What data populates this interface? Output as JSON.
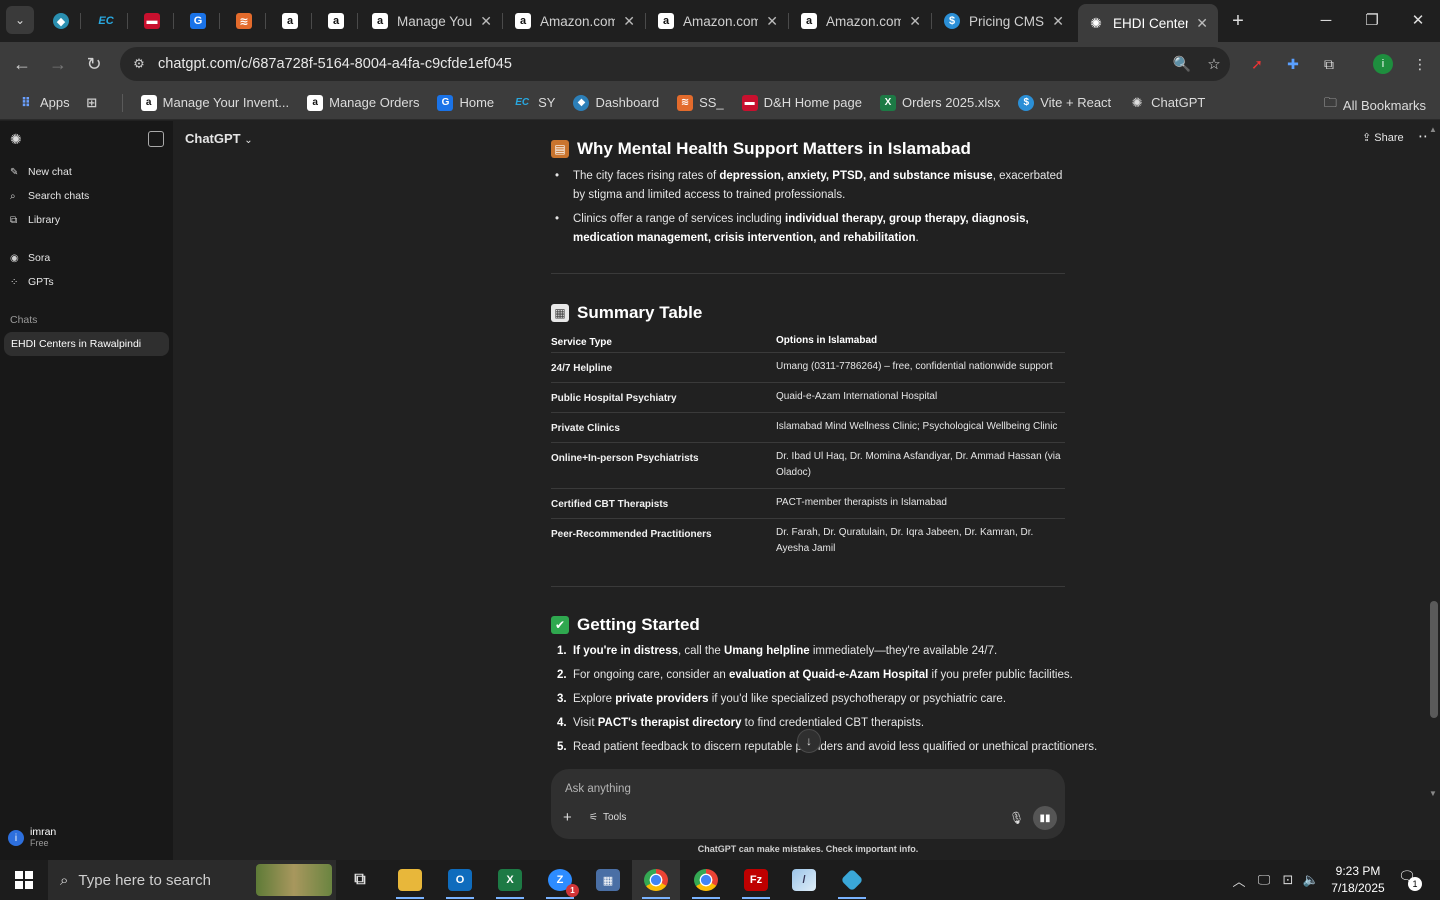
{
  "browser": {
    "tabs": [
      {
        "label": "Manage Your",
        "fav": "a",
        "fav_color": "#ffffff"
      },
      {
        "label": "Amazon.com",
        "fav": "a",
        "fav_color": "#ffffff"
      },
      {
        "label": "Amazon.com",
        "fav": "a",
        "fav_color": "#ffffff"
      },
      {
        "label": "Amazon.com",
        "fav": "a",
        "fav_color": "#ffffff"
      },
      {
        "label": "Pricing CMS",
        "fav": "$",
        "fav_color": "#2b8fd6"
      },
      {
        "label": "EHDI Centers",
        "fav": "✺",
        "fav_color": "#ffffff"
      }
    ],
    "url": "chatgpt.com/c/687a728f-5164-8004-a4fa-c9cfde1ef045",
    "bookmarks": [
      {
        "label": "Apps",
        "icon": "apps-grid-icon"
      },
      {
        "label": "Manage Your Invent...",
        "icon": "amazon-icon"
      },
      {
        "label": "Manage Orders",
        "icon": "amazon-icon"
      },
      {
        "label": "Home",
        "icon": "home-icon"
      },
      {
        "label": "SY",
        "icon": "ec-icon"
      },
      {
        "label": "Dashboard",
        "icon": "dashboard-icon"
      },
      {
        "label": "SS_",
        "icon": "ss-icon"
      },
      {
        "label": "D&H Home page",
        "icon": "dh-icon"
      },
      {
        "label": "Orders 2025.xlsx",
        "icon": "excel-icon"
      },
      {
        "label": "Vite + React",
        "icon": "vite-icon"
      },
      {
        "label": "ChatGPT",
        "icon": "chatgpt-icon"
      }
    ],
    "all_bookmarks": "All Bookmarks",
    "profile_initial": "i"
  },
  "sidebar": {
    "items": [
      {
        "label": "New chat",
        "icon": "pencil-icon"
      },
      {
        "label": "Search chats",
        "icon": "search-icon"
      },
      {
        "label": "Library",
        "icon": "library-icon"
      },
      {
        "label": "Sora",
        "icon": "sora-icon"
      },
      {
        "label": "GPTs",
        "icon": "gpts-icon"
      }
    ],
    "chats_heading": "Chats",
    "active_chat": "EHDI Centers in Rawalpindi",
    "user": {
      "initial": "i",
      "name": "imran",
      "plan": "Free"
    }
  },
  "header": {
    "model": "ChatGPT",
    "share": "Share"
  },
  "content": {
    "section1": {
      "title": "Why Mental Health Support Matters in Islamabad",
      "bullets": [
        {
          "pre": "The city faces rising rates of ",
          "bold": "depression, anxiety, PTSD, and substance misuse",
          "post": ", exacerbated by stigma and limited access to trained professionals."
        },
        {
          "pre": "Clinics offer a range of services including ",
          "bold": "individual therapy, group therapy, diagnosis, medication management, crisis intervention, and rehabilitation",
          "post": "."
        }
      ]
    },
    "section2": {
      "title": "Summary Table",
      "headers": [
        "Service Type",
        "Options in Islamabad"
      ],
      "rows": [
        [
          "24/7 Helpline",
          "Umang (0311-7786264) – free, confidential nationwide support"
        ],
        [
          "Public Hospital Psychiatry",
          "Quaid-e-Azam International Hospital"
        ],
        [
          "Private Clinics",
          "Islamabad Mind Wellness Clinic; Psychological Wellbeing Clinic"
        ],
        [
          "Online+In-person Psychiatrists",
          "Dr. Ibad Ul Haq, Dr. Momina Asfandiyar, Dr. Ammad Hassan (via Oladoc)"
        ],
        [
          "Certified CBT Therapists",
          "PACT-member therapists in Islamabad"
        ],
        [
          "Peer-Recommended Practitioners",
          "Dr. Farah, Dr. Quratulain, Dr. Iqra Jabeen, Dr. Kamran, Dr. Ayesha Jamil"
        ]
      ]
    },
    "section3": {
      "title": "Getting Started",
      "steps": [
        {
          "n": "1.",
          "bold": "If you're in distress",
          "mid": ", call the ",
          "bold2": "Umang helpline",
          "post": " immediately—they're available 24/7."
        },
        {
          "n": "2.",
          "bold": "",
          "mid": "For ongoing care, consider an ",
          "bold2": "evaluation at Quaid-e-Azam Hospital",
          "post": " if you prefer public facilities."
        },
        {
          "n": "3.",
          "bold": "",
          "mid": "Explore ",
          "bold2": "private providers",
          "post": " if you'd like specialized psychotherapy or psychiatric care."
        },
        {
          "n": "4.",
          "bold": "",
          "mid": "Visit ",
          "bold2": "PACT's therapist directory",
          "post": " to find credentialed CBT therapists."
        },
        {
          "n": "5.",
          "bold": "",
          "mid": "Read patient feedback to discern reputable providers and avoid less qualified or unethical practitioners.",
          "bold2": "",
          "post": ""
        }
      ]
    }
  },
  "composer": {
    "placeholder": "Ask anything",
    "tools": "Tools",
    "disclaimer": "ChatGPT can make mistakes. Check important info."
  },
  "taskbar": {
    "search_placeholder": "Type here to search",
    "time": "9:23 PM",
    "date": "7/18/2025",
    "notifications": "1",
    "zoom_badge": "1"
  }
}
